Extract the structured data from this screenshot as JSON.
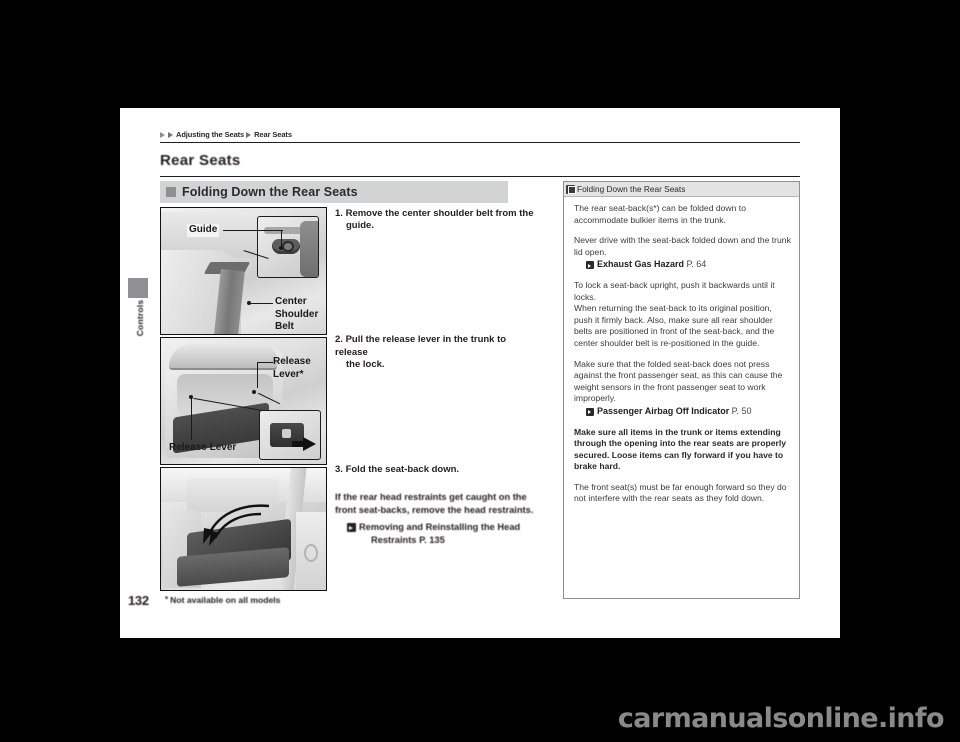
{
  "breadcrumb": {
    "parent": "Adjusting the Seats",
    "current": "Rear Seats"
  },
  "page_title": "Rear Seats",
  "section_header": "Folding Down the Rear Seats",
  "chapter_tab": "Controls",
  "figures": [
    {
      "id": "fig1",
      "labels": {
        "guide": "Guide",
        "center_shoulder_belt": "Center\nShoulder\nBelt"
      }
    },
    {
      "id": "fig2",
      "labels": {
        "release_lever_top": "Release\nLever*",
        "release_lever_bottom": "Release Lever"
      }
    },
    {
      "id": "fig3",
      "labels": {}
    }
  ],
  "steps": [
    {
      "num": "1.",
      "line1": "Remove the center shoulder belt from the",
      "line2": "guide."
    },
    {
      "num": "2.",
      "line1": "Pull the release lever in the trunk to release",
      "line2": "the lock."
    },
    {
      "num": "3.",
      "line1": "Fold the seat-back down.",
      "line2": ""
    }
  ],
  "note": {
    "line1": "If the rear head restraints get caught on the",
    "line2": "front seat-backs, remove the head restraints.",
    "ref_title_line1": "Removing and Reinstalling the Head",
    "ref_title_line2": "Restraints",
    "ref_page": "P. 135"
  },
  "sidebar": {
    "header": "Folding Down the Rear Seats",
    "paragraphs": [
      "The rear seat-back(s*) can be folded down to accommodate bulkier items in the trunk.",
      "Never drive with the seat-back folded down and the trunk lid open.",
      "To lock a seat-back upright, push it backwards until it locks.\nWhen returning the seat-back to its original position, push it firmly back. Also, make sure all rear shoulder belts are positioned in front of the seat-back, and the center shoulder belt is re-positioned in the guide.",
      "Make sure that the folded seat-back does not press against the front passenger seat, as this can cause the weight sensors in the front passenger seat to work improperly.",
      "Make sure all items in the trunk or items extending through the opening into the rear seats are properly secured. Loose items can fly forward if you have to brake hard.",
      "The front seat(s) must be far enough forward so they do not interfere with the rear seats as they fold down."
    ],
    "refs": [
      {
        "title": "Exhaust Gas Hazard",
        "page": "P. 64"
      },
      {
        "title": "Passenger Airbag Off Indicator",
        "page": "P. 50"
      }
    ]
  },
  "footer": {
    "folio": "132",
    "footnote_star": "*",
    "footnote_text": "Not available on all models"
  },
  "watermark": "carmanualsonline.info",
  "colors": {
    "band_grey": "#d2d3d5",
    "tab_grey": "#8e9094",
    "sidebar_head_grey": "#e3e3e3",
    "ink": "#231f20",
    "paper": "#ffffff",
    "backdrop": "#000000"
  }
}
